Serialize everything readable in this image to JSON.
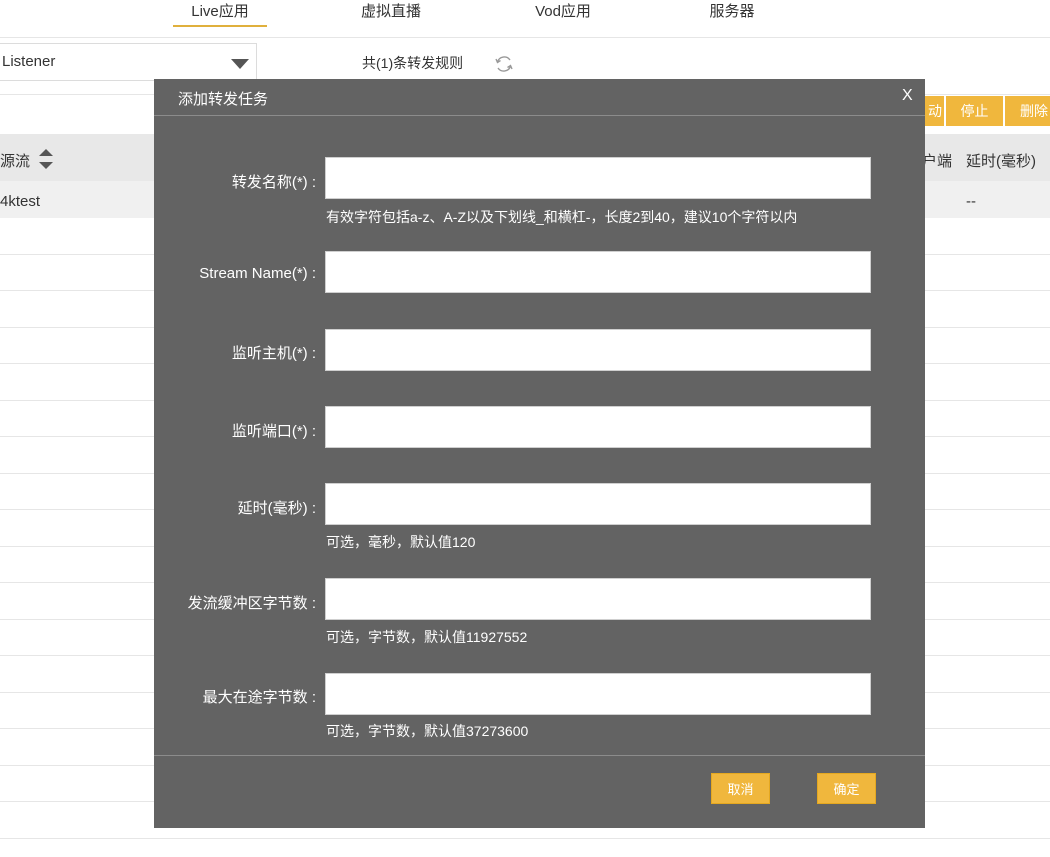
{
  "nav": {
    "tabs": [
      {
        "label": "Live应用",
        "active": true
      },
      {
        "label": "虚拟直播",
        "active": false
      },
      {
        "label": "Vod应用",
        "active": false
      },
      {
        "label": "服务器",
        "active": false
      }
    ]
  },
  "toolbar": {
    "mode_select_value": "Listener",
    "rule_count_text": "共(1)条转发规则",
    "btn_partial_left": "动",
    "btn_stop": "停止",
    "btn_delete_partial": "删除"
  },
  "table": {
    "header_source_partial": "源流",
    "header_client_partial": "户端",
    "header_delay": "延时(毫秒)",
    "row1_source_partial": "4ktest",
    "row1_delay": "--"
  },
  "dialog": {
    "title": "添加转发任务",
    "close_label": "X",
    "fields": [
      {
        "label": "转发名称(*) :",
        "value": "",
        "hint": "有效字符包括a-z、A-Z以及下划线_和横杠-，长度2到40，建议10个字符以内"
      },
      {
        "label": "Stream Name(*) :",
        "value": "",
        "hint": ""
      },
      {
        "label": "监听主机(*) :",
        "value": "",
        "hint": ""
      },
      {
        "label": "监听端口(*) :",
        "value": "",
        "hint": ""
      },
      {
        "label": "延时(毫秒) :",
        "value": "",
        "hint": "可选，毫秒，默认值120"
      },
      {
        "label": "发流缓冲区字节数 :",
        "value": "",
        "hint": "可选，字节数，默认值11927552"
      },
      {
        "label": "最大在途字节数 :",
        "value": "",
        "hint": "可选，字节数，默认值37273600"
      }
    ],
    "cancel_label": "取消",
    "confirm_label": "确定"
  },
  "colors": {
    "accent": "#f0b73d",
    "modal_bg": "#636363",
    "header_bg": "#e8e8e8"
  }
}
